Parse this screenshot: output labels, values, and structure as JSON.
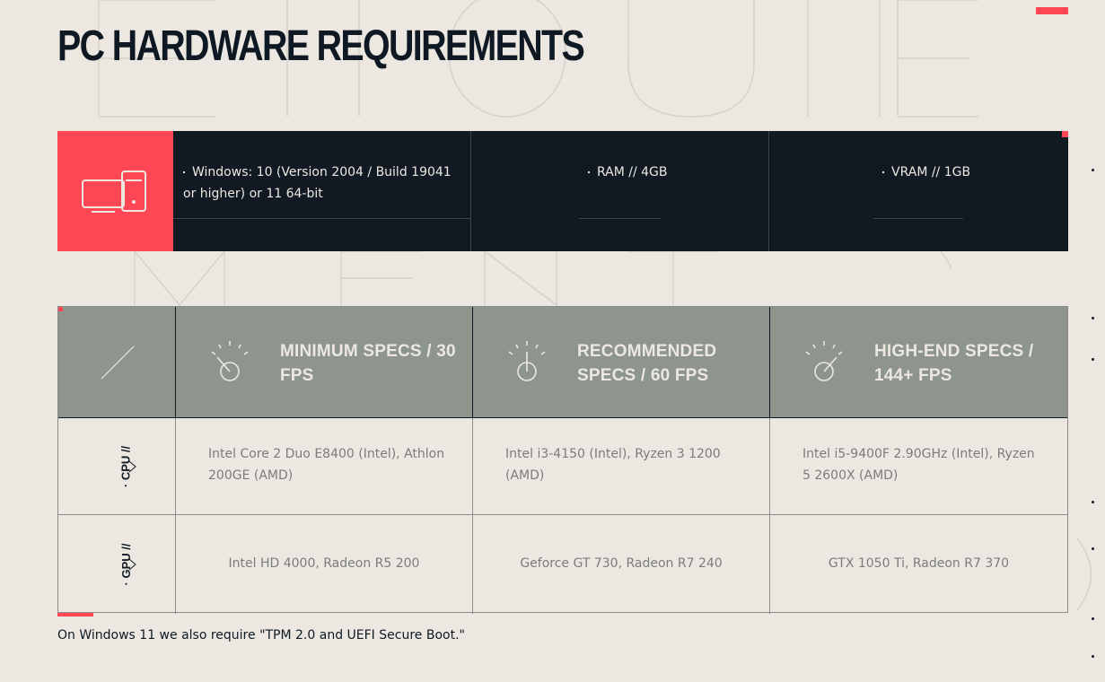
{
  "title": "PC HARDWARE REQUIREMENTS",
  "os_row": {
    "os": "Windows: 10 (Version 2004 / Build 19041 or higher) or 11 64-bit",
    "ram": "RAM // 4GB",
    "vram": "VRAM // 1GB"
  },
  "headers": {
    "min": "MINIMUM SPECS / 30 FPS",
    "rec": "RECOMMENDED SPECS / 60 FPS",
    "high": "HIGH-END SPECS / 144+ FPS"
  },
  "rows": [
    {
      "label": "· CPU //",
      "min": "Intel Core 2 Duo E8400 (Intel), Athlon 200GE (AMD)",
      "rec": "Intel i3-4150 (Intel), Ryzen 3 1200 (AMD)",
      "high": "Intel i5-9400F 2.90GHz (Intel), Ryzen 5 2600X (AMD)"
    },
    {
      "label": "· GPU //",
      "min": "Intel HD 4000, Radeon R5 200",
      "rec": "Geforce GT 730, Radeon R7 240",
      "high": "GTX 1050 Ti, Radeon R7 370"
    }
  ],
  "footnote": "On Windows 11 we also require \"TPM 2.0 and UEFI Secure Boot.\"",
  "colors": {
    "accent": "#ff4655",
    "dark": "#0f1923",
    "background": "#ece8e1",
    "header_gray": "#8d958d"
  },
  "icons": [
    "computer-icon",
    "gauge-min-icon",
    "gauge-rec-icon",
    "gauge-high-icon",
    "chevron-right-icon"
  ]
}
